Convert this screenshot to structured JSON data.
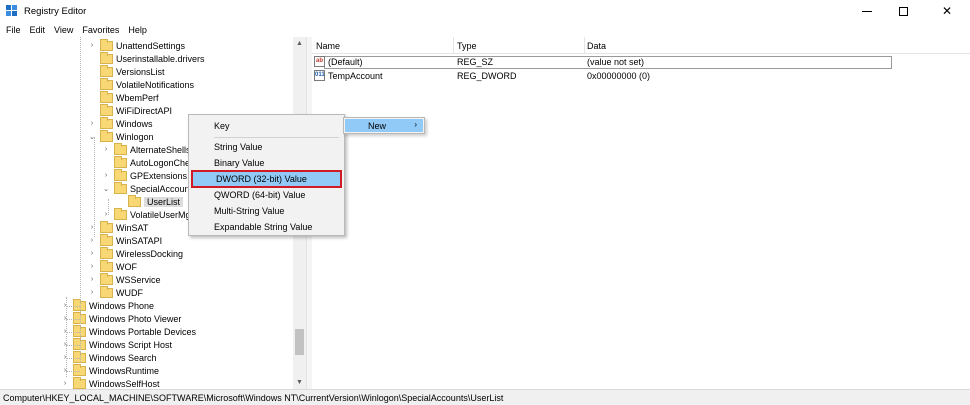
{
  "window": {
    "title": "Registry Editor",
    "minimize": "—",
    "maximize": "",
    "close": "✕"
  },
  "menu": [
    "File",
    "Edit",
    "View",
    "Favorites",
    "Help"
  ],
  "tree": [
    {
      "label": "UnattendSettings",
      "expander": "›"
    },
    {
      "label": "Userinstallable.drivers",
      "expander": ""
    },
    {
      "label": "VersionsList",
      "expander": ""
    },
    {
      "label": "VolatileNotifications",
      "expander": ""
    },
    {
      "label": "WbemPerf",
      "expander": ""
    },
    {
      "label": "WiFiDirectAPI",
      "expander": ""
    },
    {
      "label": "Windows",
      "expander": "›"
    },
    {
      "label": "Winlogon",
      "expander": "⌄"
    },
    {
      "label": "AlternateShells",
      "expander": "›"
    },
    {
      "label": "AutoLogonChe",
      "expander": ""
    },
    {
      "label": "GPExtensions",
      "expander": "›"
    },
    {
      "label": "SpecialAccount",
      "expander": "⌄"
    },
    {
      "label": "UserList",
      "expander": ""
    },
    {
      "label": "VolatileUserMgr",
      "expander": "›"
    },
    {
      "label": "WinSAT",
      "expander": "›"
    },
    {
      "label": "WinSATAPI",
      "expander": "›"
    },
    {
      "label": "WirelessDocking",
      "expander": "›"
    },
    {
      "label": "WOF",
      "expander": "›"
    },
    {
      "label": "WSService",
      "expander": "›"
    },
    {
      "label": "WUDF",
      "expander": "›"
    },
    {
      "label": "Windows Phone",
      "expander": "›"
    },
    {
      "label": "Windows Photo Viewer",
      "expander": "›"
    },
    {
      "label": "Windows Portable Devices",
      "expander": "›"
    },
    {
      "label": "Windows Script Host",
      "expander": "›"
    },
    {
      "label": "Windows Search",
      "expander": "›"
    },
    {
      "label": "WindowsRuntime",
      "expander": "›"
    },
    {
      "label": "WindowsSelfHost",
      "expander": "›"
    }
  ],
  "list": {
    "columns": [
      "Name",
      "Type",
      "Data"
    ],
    "rows": [
      {
        "icon": "string-value-icon",
        "glyph": "ab",
        "name": "(Default)",
        "type": "REG_SZ",
        "data": "(value not set)"
      },
      {
        "icon": "binary-value-icon",
        "glyph": "011",
        "name": "TempAccount",
        "type": "REG_DWORD",
        "data": "0x00000000 (0)"
      }
    ]
  },
  "context_menu": {
    "items": [
      "Key",
      "String Value",
      "Binary Value",
      "DWORD (32-bit) Value",
      "QWORD (64-bit) Value",
      "Multi-String Value",
      "Expandable String Value"
    ],
    "highlighted": "DWORD (32-bit) Value"
  },
  "submenu_parent": {
    "label": "New",
    "arrow": "›"
  },
  "status": {
    "path": "Computer\\HKEY_LOCAL_MACHINE\\SOFTWARE\\Microsoft\\Windows NT\\CurrentVersion\\Winlogon\\SpecialAccounts\\UserList"
  },
  "scrollbar": {
    "up": "▲",
    "down": "▼"
  },
  "colors": {
    "highlight": "#91c9f7",
    "callout_border": "#d01b25",
    "folder": "#f8d775"
  }
}
